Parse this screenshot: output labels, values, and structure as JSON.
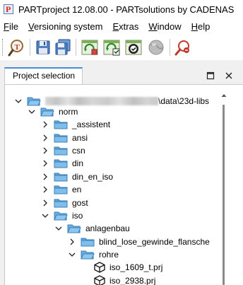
{
  "window": {
    "title": "PARTproject 12.08.00 - PARTsolutions by CADENAS",
    "app_icon": "partproject-app-icon"
  },
  "menu": [
    {
      "label": "File",
      "underline": "F",
      "rest": "ile"
    },
    {
      "label": "Versioning system",
      "underline": "V",
      "rest": "ersioning system"
    },
    {
      "label": "Extras",
      "underline": "E",
      "rest": "xtras"
    },
    {
      "label": "Window",
      "underline": "W",
      "rest": "indow"
    },
    {
      "label": "Help",
      "underline": "H",
      "rest": "elp"
    }
  ],
  "toolbar": {
    "buttons": [
      {
        "name": "search-parts-icon"
      },
      {
        "name": "save-icon"
      },
      {
        "name": "save-all-icon"
      },
      {
        "name": "versioning-update-icon"
      },
      {
        "name": "versioning-sync-icon"
      },
      {
        "name": "versioning-check-icon"
      },
      {
        "name": "globe-icon"
      },
      {
        "name": "search-remove-icon"
      }
    ]
  },
  "panel": {
    "tab_label": "Project selection",
    "maximize_icon": "maximize-icon",
    "close_icon": "close-icon"
  },
  "tree": {
    "root": {
      "path_visible": "\\data\\23d-libs"
    },
    "items": [
      {
        "label": "norm",
        "expanded": true,
        "type": "folder"
      },
      {
        "label": "_assistent",
        "expanded": false,
        "type": "folder"
      },
      {
        "label": "ansi",
        "expanded": false,
        "type": "folder"
      },
      {
        "label": "csn",
        "expanded": false,
        "type": "folder"
      },
      {
        "label": "din",
        "expanded": false,
        "type": "folder"
      },
      {
        "label": "din_en_iso",
        "expanded": false,
        "type": "folder"
      },
      {
        "label": "en",
        "expanded": false,
        "type": "folder"
      },
      {
        "label": "gost",
        "expanded": false,
        "type": "folder"
      },
      {
        "label": "iso",
        "expanded": true,
        "type": "folder"
      },
      {
        "label": "anlagenbau",
        "expanded": true,
        "type": "folder"
      },
      {
        "label": "blind_lose_gewinde_flansche",
        "expanded": false,
        "type": "folder"
      },
      {
        "label": "rohre",
        "expanded": true,
        "type": "folder"
      },
      {
        "label": "iso_1609_t.prj",
        "expanded": false,
        "type": "project"
      },
      {
        "label": "iso_2938.prj",
        "expanded": false,
        "type": "project"
      }
    ]
  }
}
